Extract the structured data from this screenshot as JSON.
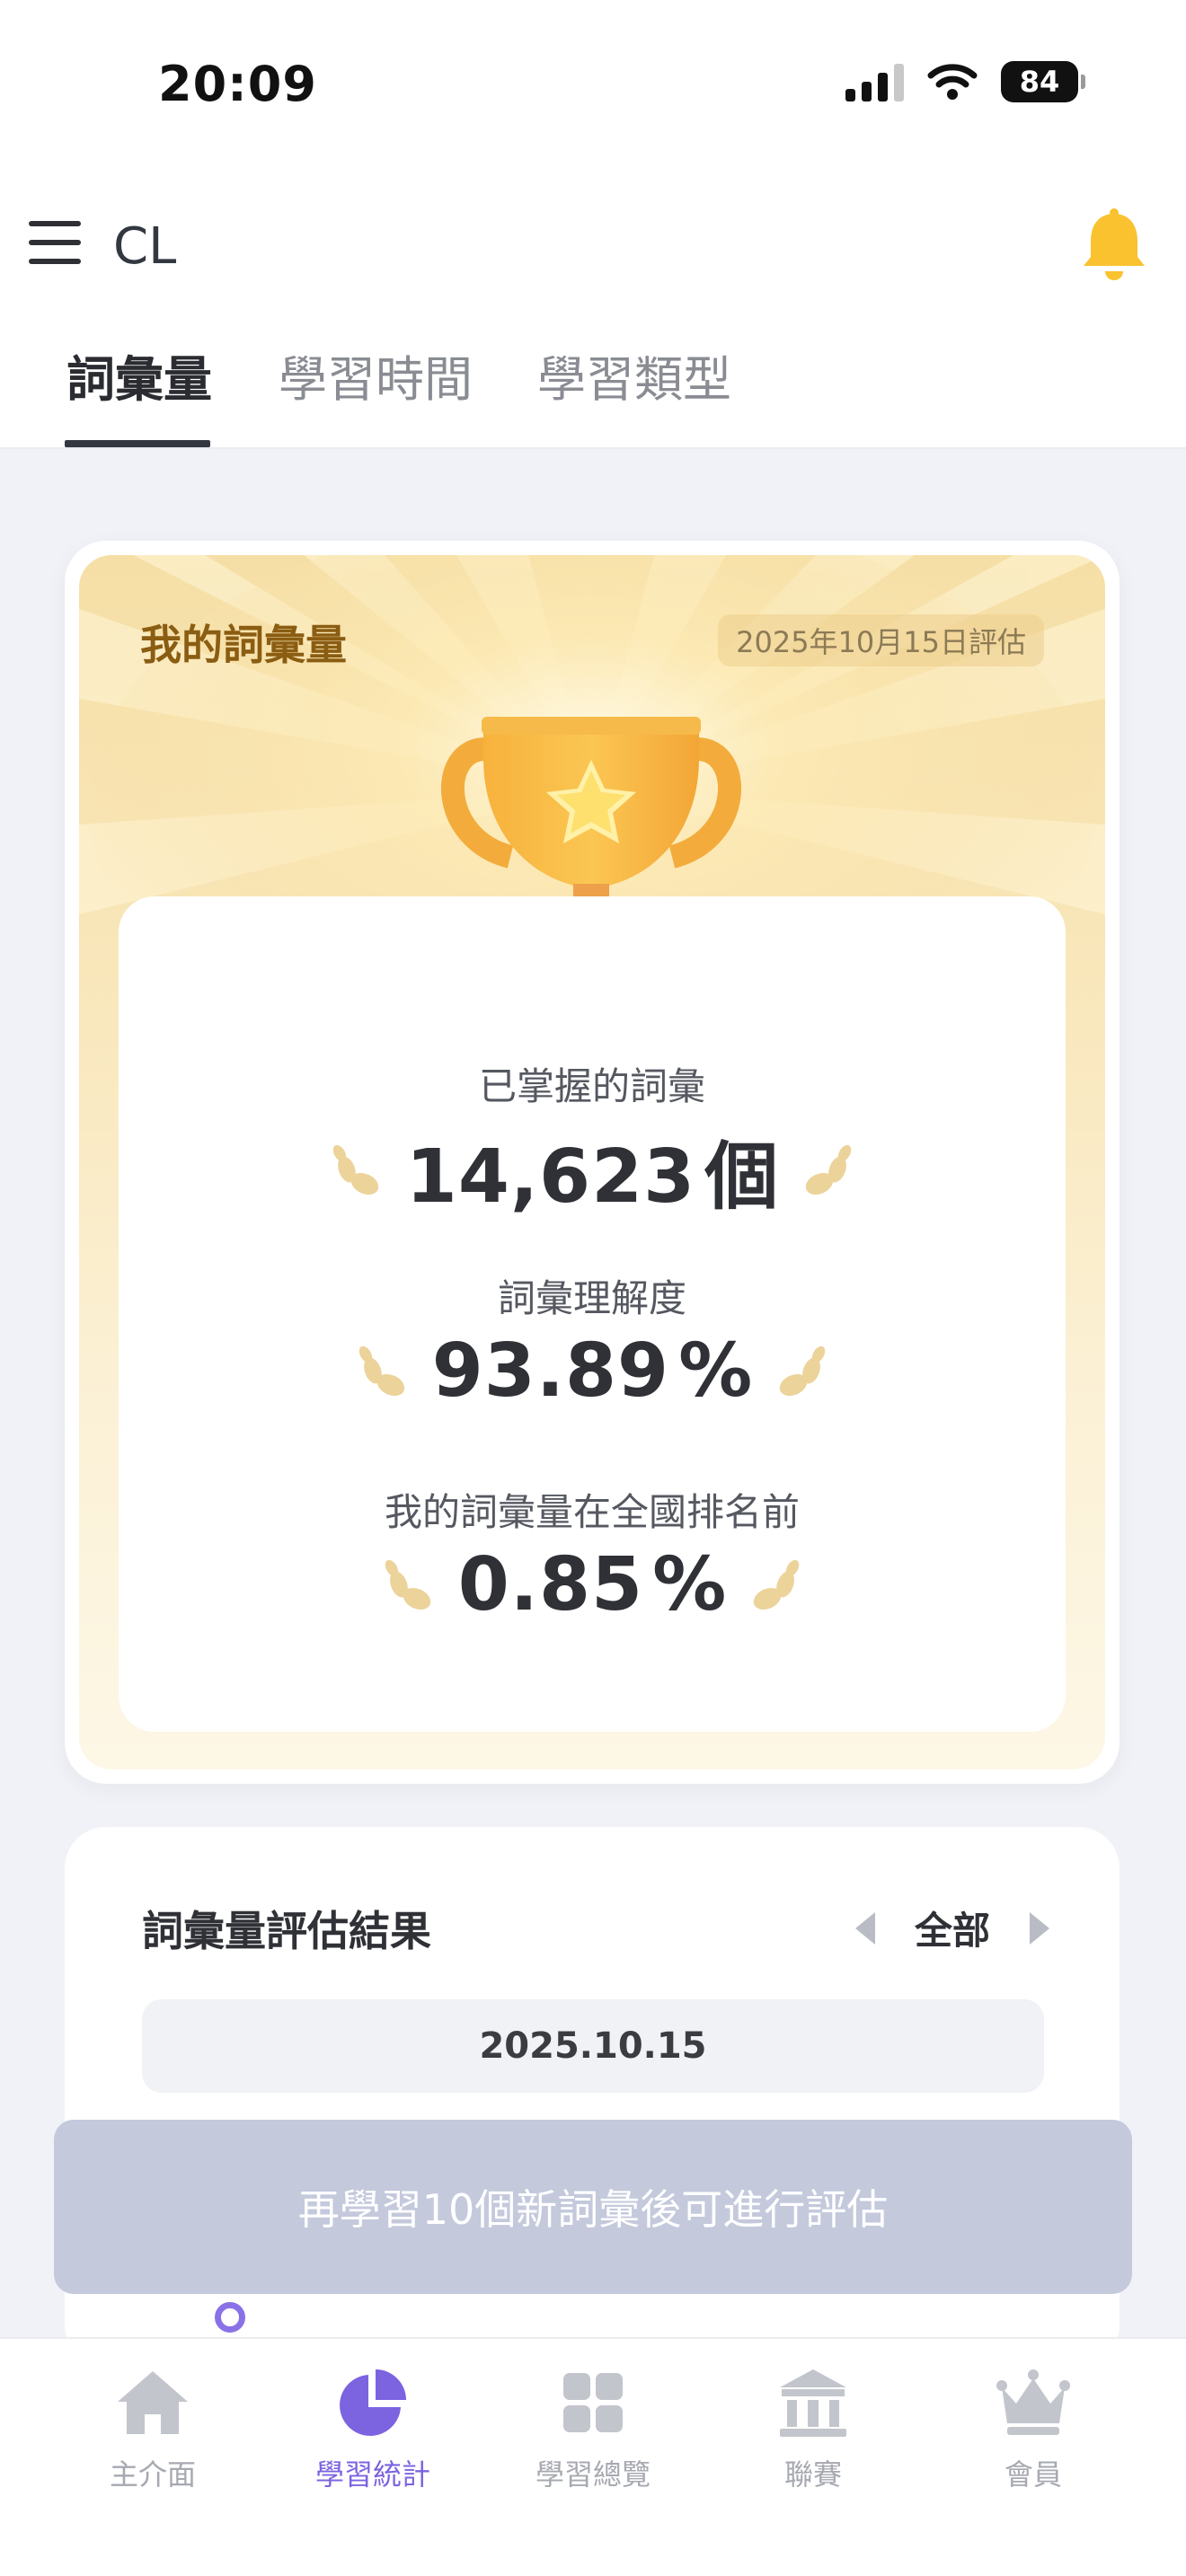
{
  "status_bar": {
    "time": "20:09",
    "battery": "84"
  },
  "header": {
    "user_name": "CL"
  },
  "tabs": [
    {
      "label": "詞彙量",
      "active": true
    },
    {
      "label": "學習時間",
      "active": false
    },
    {
      "label": "學習類型",
      "active": false
    }
  ],
  "vocab_card": {
    "title": "我的詞彙量",
    "eval_date": "2025年10月15日評估",
    "stats": [
      {
        "label": "已掌握的詞彙",
        "value": "14,623",
        "unit": "個"
      },
      {
        "label": "詞彙理解度",
        "value": "93.89",
        "unit": "%"
      },
      {
        "label": "我的詞彙量在全國排名前",
        "value": "0.85",
        "unit": "%"
      }
    ]
  },
  "results_card": {
    "title": "詞彙量評估結果",
    "filter_label": "全部",
    "date": "2025.10.15"
  },
  "banner": {
    "text": "再學習10個新詞彙後可進行評估"
  },
  "bottom_nav": [
    {
      "label": "主介面",
      "icon": "home-icon",
      "active": false
    },
    {
      "label": "學習統計",
      "icon": "pie-chart-icon",
      "active": true
    },
    {
      "label": "學習總覽",
      "icon": "grid-icon",
      "active": false
    },
    {
      "label": "聯賽",
      "icon": "bank-icon",
      "active": false
    },
    {
      "label": "會員",
      "icon": "crown-icon",
      "active": false
    }
  ],
  "colors": {
    "accent": "#7c63e0",
    "gold_title": "#8a5d12",
    "bell": "#f9c22e",
    "banner": "#c4c9dc"
  }
}
